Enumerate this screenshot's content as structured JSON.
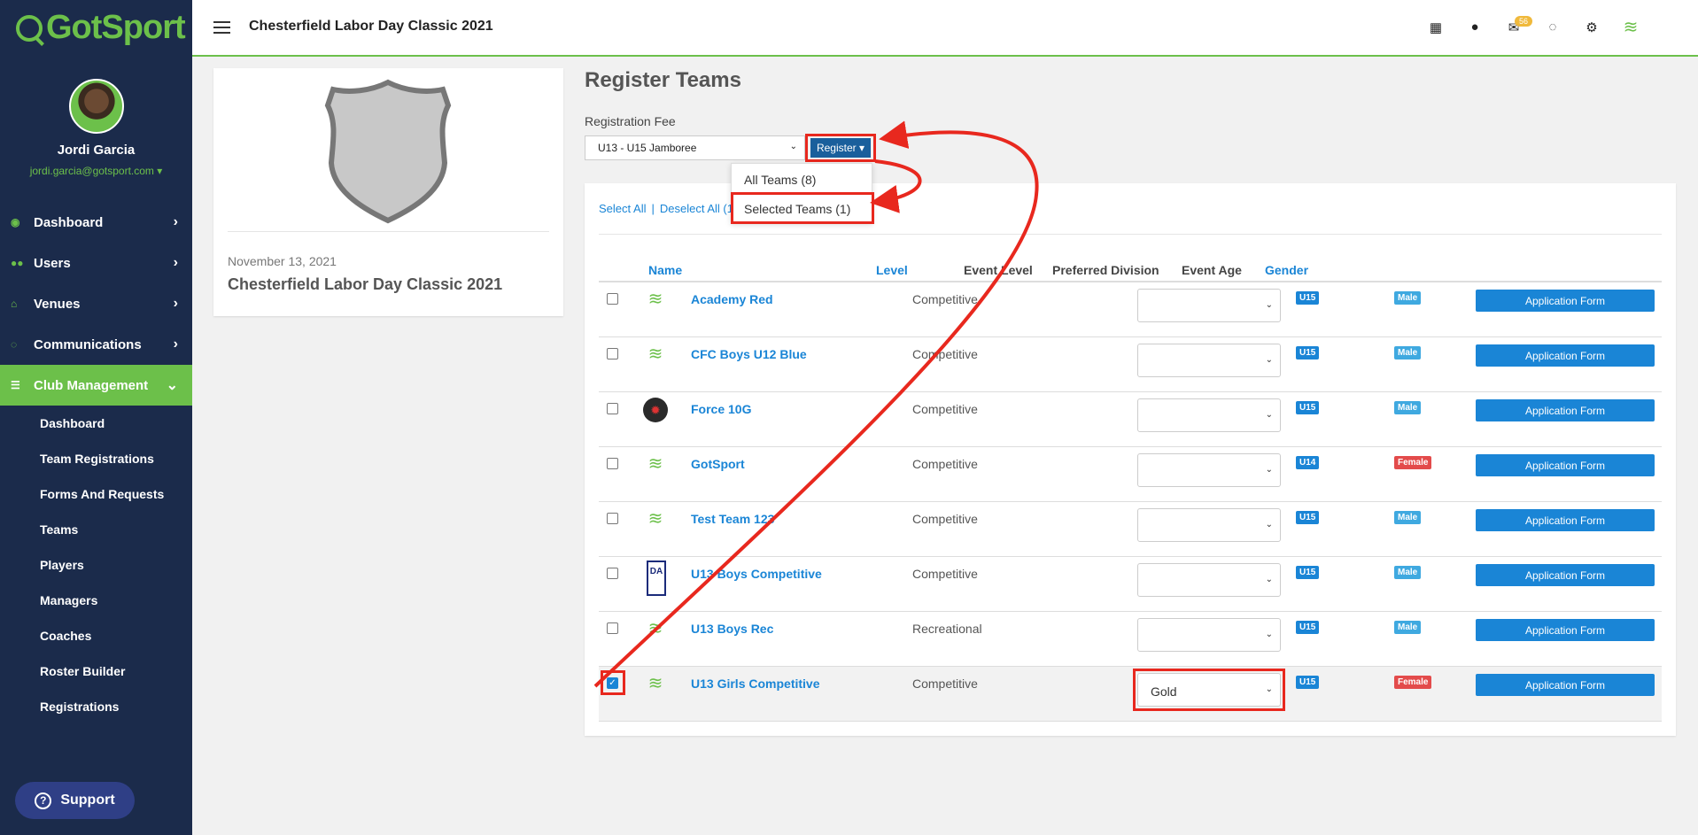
{
  "brand": {
    "name": "GotSport",
    "accent": "#6cc04a",
    "sidebar_bg": "#1b2b4b",
    "link": "#1a85d6",
    "annotation": "#e8281e"
  },
  "user": {
    "name": "Jordi Garcia",
    "email": "jordi.garcia@gotsport.com"
  },
  "nav": {
    "items": [
      {
        "label": "Dashboard",
        "icon": "dashboard-icon"
      },
      {
        "label": "Users",
        "icon": "users-icon"
      },
      {
        "label": "Venues",
        "icon": "venues-icon"
      },
      {
        "label": "Communications",
        "icon": "chat-icon"
      },
      {
        "label": "Club Management",
        "icon": "club-icon"
      }
    ],
    "sub_items": [
      "Dashboard",
      "Team Registrations",
      "Forms And Requests",
      "Teams",
      "Players",
      "Managers",
      "Coaches",
      "Roster Builder",
      "Registrations"
    ]
  },
  "support_label": "Support",
  "topbar": {
    "title": "Chesterfield Labor Day Classic 2021",
    "mail_count": "56"
  },
  "event": {
    "date": "November 13, 2021",
    "name": "Chesterfield Labor Day Classic 2021"
  },
  "main": {
    "title": "Register Teams",
    "fee_label": "Registration Fee",
    "fee_value": "U13 - U15 Jamboree",
    "register_label": "Register",
    "dropdown": [
      "All Teams (8)",
      "Selected Teams (1)"
    ],
    "select_all": "Select All",
    "deselect_all": "Deselect All (1)"
  },
  "table": {
    "headers": [
      "Name",
      "Level",
      "Event Level",
      "Preferred Division",
      "Event Age",
      "Gender"
    ],
    "action_label": "Application Form",
    "rows": [
      {
        "name": "Academy Red",
        "level": "Competitive",
        "division": "",
        "age": "U15",
        "gender": "Male",
        "checked": false,
        "logo": "gotsoccer-logo"
      },
      {
        "name": "CFC Boys U12 Blue",
        "level": "Competitive",
        "division": "",
        "age": "U15",
        "gender": "Male",
        "checked": false,
        "logo": "gotsoccer-logo"
      },
      {
        "name": "Force 10G",
        "level": "Competitive",
        "division": "",
        "age": "U15",
        "gender": "Male",
        "checked": false,
        "logo": "force-logo"
      },
      {
        "name": "GotSport",
        "level": "Competitive",
        "division": "",
        "age": "U14",
        "gender": "Female",
        "checked": false,
        "logo": "gotsoccer-logo"
      },
      {
        "name": "Test Team 123",
        "level": "Competitive",
        "division": "",
        "age": "U15",
        "gender": "Male",
        "checked": false,
        "logo": "gotsoccer-logo"
      },
      {
        "name": "U13 Boys Competitive",
        "level": "Competitive",
        "division": "",
        "age": "U15",
        "gender": "Male",
        "checked": false,
        "logo": "da-logo"
      },
      {
        "name": "U13 Boys Rec",
        "level": "Recreational",
        "division": "",
        "age": "U15",
        "gender": "Male",
        "checked": false,
        "logo": "gotsoccer-logo"
      },
      {
        "name": "U13 Girls Competitive",
        "level": "Competitive",
        "division": "Gold",
        "age": "U15",
        "gender": "Female",
        "checked": true,
        "logo": "gotsoccer-logo"
      }
    ]
  }
}
